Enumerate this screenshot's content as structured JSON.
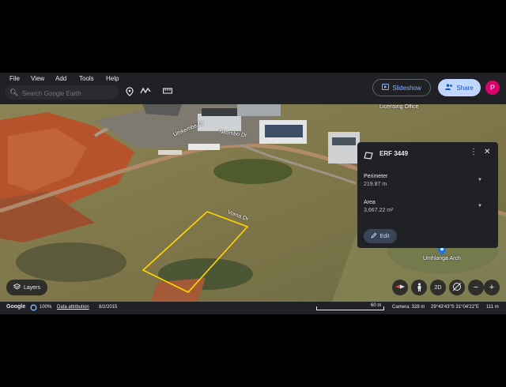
{
  "menu": [
    "File",
    "View",
    "Add",
    "Tools",
    "Help"
  ],
  "search": {
    "placeholder": "Search Google Earth"
  },
  "toolbar": {
    "slideshow_label": "Slideshow",
    "share_label": "Share",
    "avatar_letter": "P"
  },
  "map_labels": {
    "licensing_office": "Licensing Office",
    "street1": "Umkembe Dr",
    "street2": "Nkombo Dr",
    "street3": "Vorna Dr",
    "umhlanga": "Umhlanga Arch"
  },
  "panel": {
    "title": "ERF 3449",
    "perimeter_label": "Perimeter",
    "perimeter_value": "219.87 m",
    "area_label": "Area",
    "area_value": "3,667.22 m²",
    "edit_label": "Edit"
  },
  "controls": {
    "layers_label": "Layers",
    "two_d_label": "2D",
    "zoom_out": "−",
    "zoom_in": "+"
  },
  "status": {
    "google": "Google",
    "percent": "100%",
    "attribution": "Data attribution",
    "date": "8/2/2015",
    "scale": "60 m",
    "camera": "Camera: 328 m",
    "coords": "29°43'43\"S 31°04'22\"E",
    "elevation": "111 m"
  },
  "colors": {
    "app_bg": "#202124",
    "share_bg": "#c2d7ff",
    "polygon": "#ffd600",
    "accent": "#8ab4f8"
  }
}
